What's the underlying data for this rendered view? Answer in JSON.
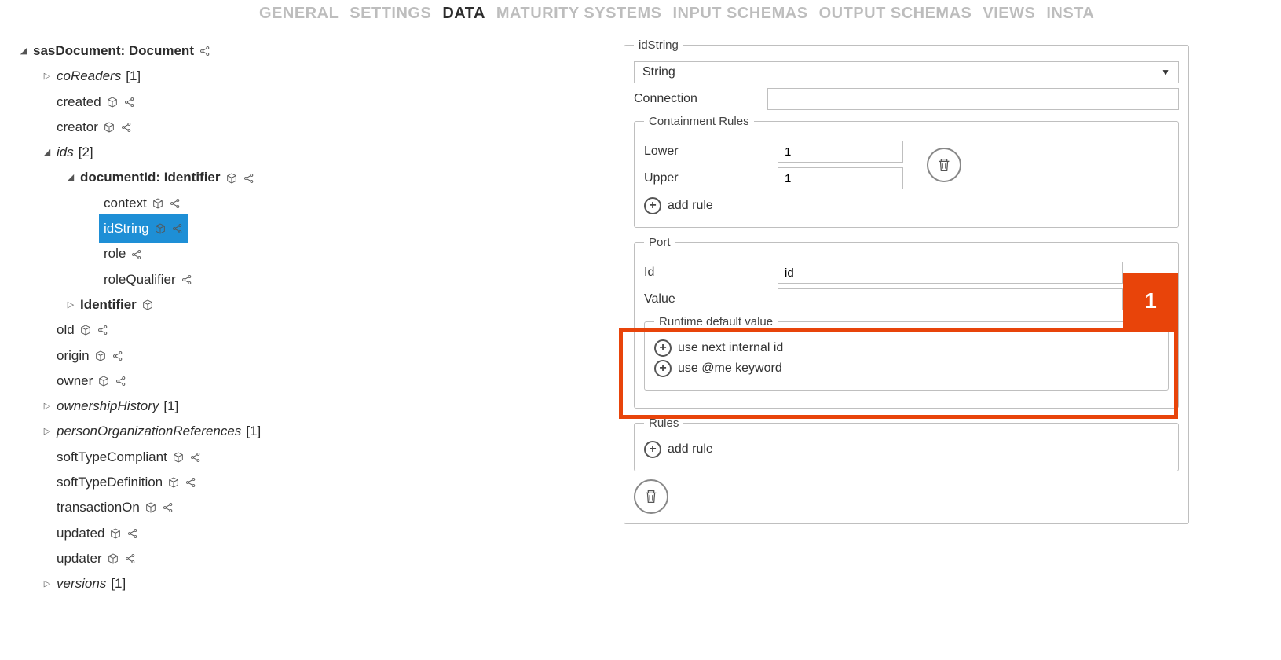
{
  "tabs": {
    "general": "GENERAL",
    "settings": "SETTINGS",
    "data": "DATA",
    "maturity": "MATURITY SYSTEMS",
    "inputSchemas": "INPUT SCHEMAS",
    "outputSchemas": "OUTPUT SCHEMAS",
    "views": "VIEWS",
    "insta": "INSTA"
  },
  "tree": {
    "root": "sasDocument:  Document",
    "coReaders": "coReaders",
    "coReadersCount": "[1]",
    "created": "created",
    "creator": "creator",
    "ids": "ids",
    "idsCount": "[2]",
    "documentId": "documentId:  Identifier",
    "context": "context",
    "idString": "idString",
    "role": "role",
    "roleQualifier": "roleQualifier",
    "identifier": "Identifier",
    "old": "old",
    "origin": "origin",
    "owner": "owner",
    "ownershipHistory": "ownershipHistory",
    "ownershipHistoryCount": "[1]",
    "personOrgRefs": "personOrganizationReferences",
    "personOrgRefsCount": "[1]",
    "softTypeCompliant": "softTypeCompliant",
    "softTypeDefinition": "softTypeDefinition",
    "transactionOn": "transactionOn",
    "updated": "updated",
    "updater": "updater",
    "versions": "versions",
    "versionsCount": "[1]"
  },
  "form": {
    "typeLegend": "idString",
    "typeValue": "String",
    "connectionLabel": "Connection",
    "connectionValue": "",
    "containment": {
      "legend": "Containment Rules",
      "lowerLabel": "Lower",
      "lowerValue": "1",
      "upperLabel": "Upper",
      "upperValue": "1",
      "addRule": "add rule"
    },
    "port": {
      "legend": "Port",
      "idLabel": "Id",
      "idValue": "id",
      "valueLabel": "Value",
      "valueValue": ""
    },
    "runtime": {
      "legend": "Runtime default value",
      "nextInternal": "use next internal id",
      "meKeyword": "use @me keyword"
    },
    "rules": {
      "legend": "Rules",
      "addRule": "add rule"
    }
  },
  "highlight": {
    "badge": "1"
  }
}
